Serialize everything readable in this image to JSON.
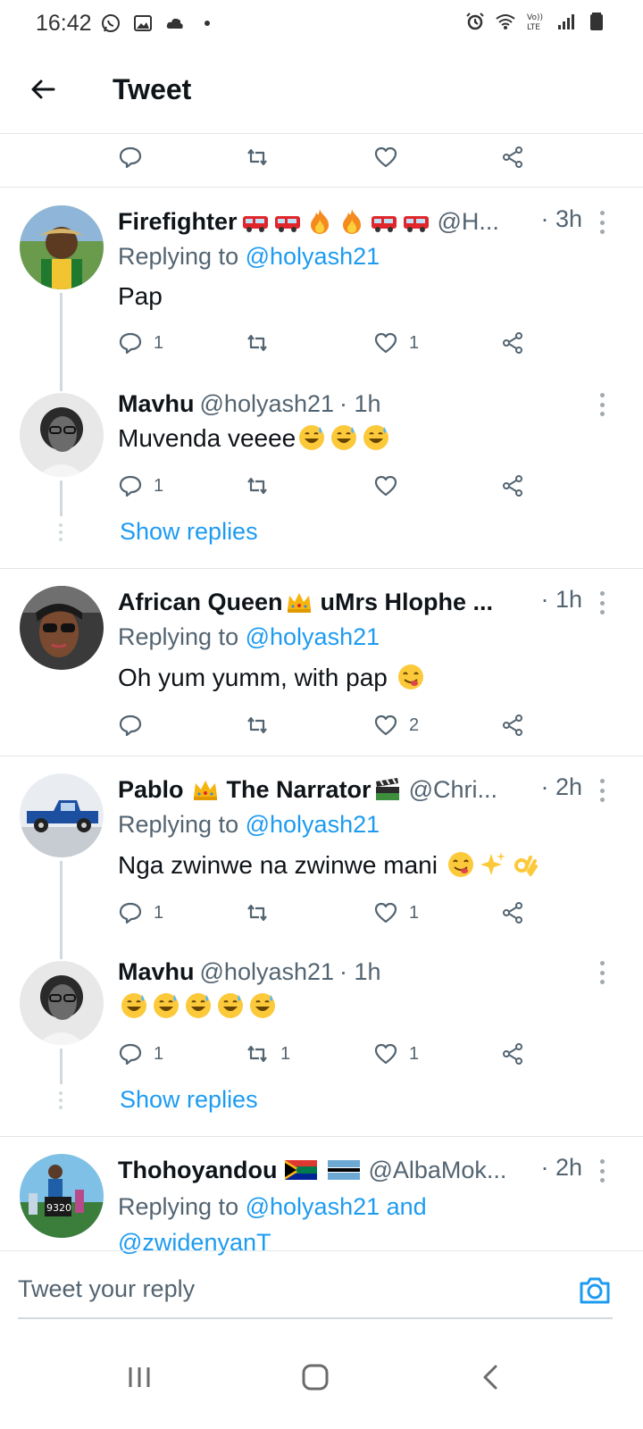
{
  "status_bar": {
    "time": "16:42",
    "left_icons": [
      "whatsapp-icon",
      "gallery-icon",
      "cloud-icon",
      "dot-icon"
    ],
    "right_icons": [
      "alarm-icon",
      "wifi-icon",
      "volte-icon",
      "signal-icon",
      "battery-icon"
    ],
    "volte_label": "Vo))\nLTE"
  },
  "header": {
    "title": "Tweet"
  },
  "tweets": [
    {
      "name": "Firefighter",
      "name_emojis": [
        "fire-engine",
        "fire-engine",
        "fire",
        "fire",
        "fire-engine",
        "fire-engine"
      ],
      "handle": "@H...",
      "time": "· 3h",
      "replying_prefix": "Replying to",
      "replying_to": "@holyash21",
      "text": "Pap",
      "reply_count": "1",
      "retweet_count": "",
      "like_count": "1"
    },
    {
      "name": "Mavhu",
      "handle": "@holyash21",
      "time": "· 1h",
      "text": "Muvenda veeee",
      "text_emojis": [
        "sweat-smile",
        "sweat-smile",
        "sweat-smile"
      ],
      "reply_count": "1",
      "retweet_count": "",
      "like_count": ""
    },
    {
      "name": "African Queen",
      "name_emojis": [
        "crown"
      ],
      "name_suffix": "uMrs Hlophe ...",
      "time": "· 1h",
      "replying_prefix": "Replying to",
      "replying_to": "@holyash21",
      "text": "Oh yum yumm, with pap",
      "text_emojis": [
        "yum"
      ],
      "reply_count": "",
      "retweet_count": "",
      "like_count": "2"
    },
    {
      "name": "Pablo",
      "name_emojis": [
        "crown"
      ],
      "name_suffix": "The Narrator",
      "name_suffix_emojis": [
        "clapper"
      ],
      "handle": "@Chri...",
      "time": "· 2h",
      "replying_prefix": "Replying to",
      "replying_to": "@holyash21",
      "text": "Nga zwinwe na zwinwe mani",
      "text_emojis": [
        "yum",
        "sparkles",
        "ok-hand"
      ],
      "reply_count": "1",
      "retweet_count": "",
      "like_count": "1"
    },
    {
      "name": "Mavhu",
      "handle": "@holyash21",
      "time": "· 1h",
      "text": "",
      "text_emojis": [
        "sweat-smile",
        "sweat-smile",
        "sweat-smile",
        "sweat-smile",
        "sweat-smile"
      ],
      "reply_count": "1",
      "retweet_count": "1",
      "like_count": "1"
    },
    {
      "name": "Thohoyandou",
      "name_emojis": [
        "flag-za",
        "flag-bw"
      ],
      "handle": "@AlbaMok...",
      "time": "· 2h",
      "replying_prefix": "Replying to",
      "replying_to": "@holyash21 and",
      "replying_to_2": "@zwidenyanT"
    }
  ],
  "show_replies_label": "Show replies",
  "reply_bar": {
    "placeholder": "Tweet your reply"
  },
  "colors": {
    "accent": "#1d9bf0",
    "muted": "#536471",
    "divider": "#e3e6e8"
  }
}
